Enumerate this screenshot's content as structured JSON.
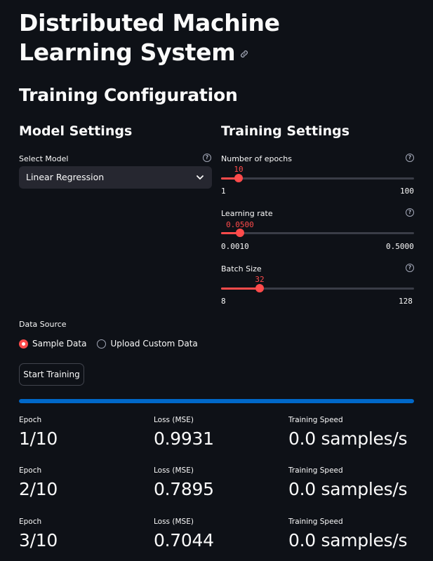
{
  "header": {
    "title": "Distributed Machine Learning System",
    "link_icon": "link-icon"
  },
  "section": {
    "title": "Training Configuration"
  },
  "model_settings": {
    "title": "Model Settings",
    "select_label": "Select Model",
    "select_value": "Linear Regression"
  },
  "training_settings": {
    "title": "Training Settings",
    "sliders": [
      {
        "label": "Number of epochs",
        "value": "10",
        "min": "1",
        "max": "100",
        "fraction": 0.091
      },
      {
        "label": "Learning rate",
        "value": "0.0500",
        "min": "0.0010",
        "max": "0.5000",
        "fraction": 0.098
      },
      {
        "label": "Batch Size",
        "value": "32",
        "min": "8",
        "max": "128",
        "fraction": 0.2
      }
    ]
  },
  "data_source": {
    "label": "Data Source",
    "options": [
      "Sample Data",
      "Upload Custom Data"
    ],
    "selected": "Sample Data"
  },
  "start_button": {
    "label": "Start Training"
  },
  "progress": {
    "fraction": 1.0,
    "color": "#0068c9"
  },
  "accent_color": "#ff4b4b",
  "metrics": [
    {
      "epoch_label": "Epoch",
      "epoch": "1/10",
      "loss_label": "Loss (MSE)",
      "loss": "0.9931",
      "speed_label": "Training Speed",
      "speed": "0.0 samples/s"
    },
    {
      "epoch_label": "Epoch",
      "epoch": "2/10",
      "loss_label": "Loss (MSE)",
      "loss": "0.7895",
      "speed_label": "Training Speed",
      "speed": "0.0 samples/s"
    },
    {
      "epoch_label": "Epoch",
      "epoch": "3/10",
      "loss_label": "Loss (MSE)",
      "loss": "0.7044",
      "speed_label": "Training Speed",
      "speed": "0.0 samples/s"
    }
  ]
}
